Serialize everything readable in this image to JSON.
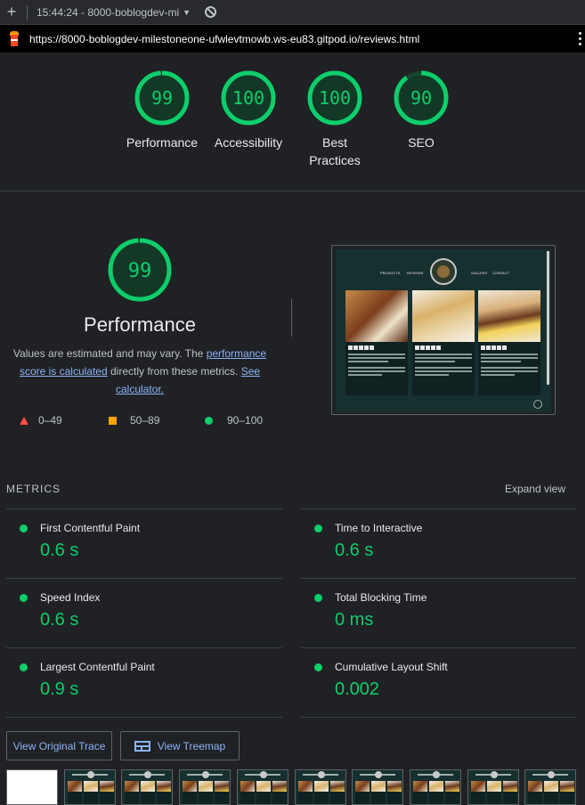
{
  "tabbar": {
    "new_tab_label": "+",
    "tab_title": "15:44:24 - 8000-boblogdev-mi",
    "dropdown_icon": "caret-down-icon",
    "block_icon": "no-entry-icon"
  },
  "urlbar": {
    "site_icon": "lighthouse-icon",
    "url": "https://8000-boblogdev-milestoneone-ufwlevtmowb.ws-eu83.gitpod.io/reviews.html",
    "menu_icon": "kebab-menu-icon"
  },
  "colors": {
    "pass": "#0cce6b",
    "average": "#ffa400",
    "fail": "#ff4e42",
    "link": "#8ab4f8",
    "background": "#202124"
  },
  "scores": [
    {
      "label": "Performance",
      "score": 99
    },
    {
      "label": "Accessibility",
      "score": 100
    },
    {
      "label": "Best Practices",
      "score": 100
    },
    {
      "label": "SEO",
      "score": 90
    }
  ],
  "performance": {
    "score": 99,
    "title": "Performance",
    "desc_prefix": "Values are estimated and may vary. The ",
    "desc_link1": "performance score is calculated",
    "desc_middle": " directly from these metrics. ",
    "desc_link2": "See calculator."
  },
  "legend": [
    {
      "label": "0–49",
      "icon": "red-triangle-icon"
    },
    {
      "label": "50–89",
      "icon": "orange-square-icon"
    },
    {
      "label": "90–100",
      "icon": "green-circle-icon"
    }
  ],
  "screenshot": {
    "nav": [
      "PRODUCTS",
      "REVIEWS",
      "GALLERY",
      "CONTACT"
    ]
  },
  "metrics": {
    "title": "METRICS",
    "expand_label": "Expand view",
    "items": [
      {
        "label": "First Contentful Paint",
        "value": "0.6 s"
      },
      {
        "label": "Time to Interactive",
        "value": "0.6 s"
      },
      {
        "label": "Speed Index",
        "value": "0.6 s"
      },
      {
        "label": "Total Blocking Time",
        "value": "0 ms"
      },
      {
        "label": "Largest Contentful Paint",
        "value": "0.9 s"
      },
      {
        "label": "Cumulative Layout Shift",
        "value": "0.002"
      }
    ]
  },
  "buttons": {
    "view_trace": "View Original Trace",
    "view_treemap": "View Treemap",
    "treemap_icon": "treemap-icon"
  }
}
